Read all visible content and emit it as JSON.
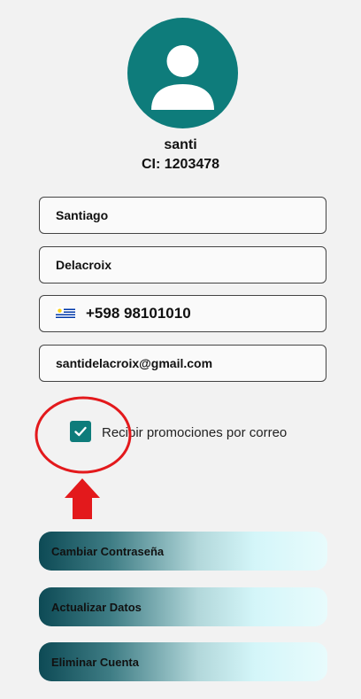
{
  "profile": {
    "avatar_icon": "person-icon",
    "name": "santi",
    "ci": "CI: 1203478"
  },
  "form": {
    "first_name": "Santiago",
    "last_name": "Delacroix",
    "phone_flag": "uruguay-flag-icon",
    "phone": "+598 98101010",
    "email": "santidelacroix@gmail.com"
  },
  "promotions": {
    "checked": true,
    "label": "Recibir promociones por correo"
  },
  "annotation": {
    "color": "#e3191c"
  },
  "actions": {
    "change_password": "Cambiar Contraseña",
    "update_data": "Actualizar Datos",
    "delete_account": "Eliminar Cuenta"
  },
  "colors": {
    "accent": "#0e7c7b",
    "annotation": "#e3191c"
  }
}
